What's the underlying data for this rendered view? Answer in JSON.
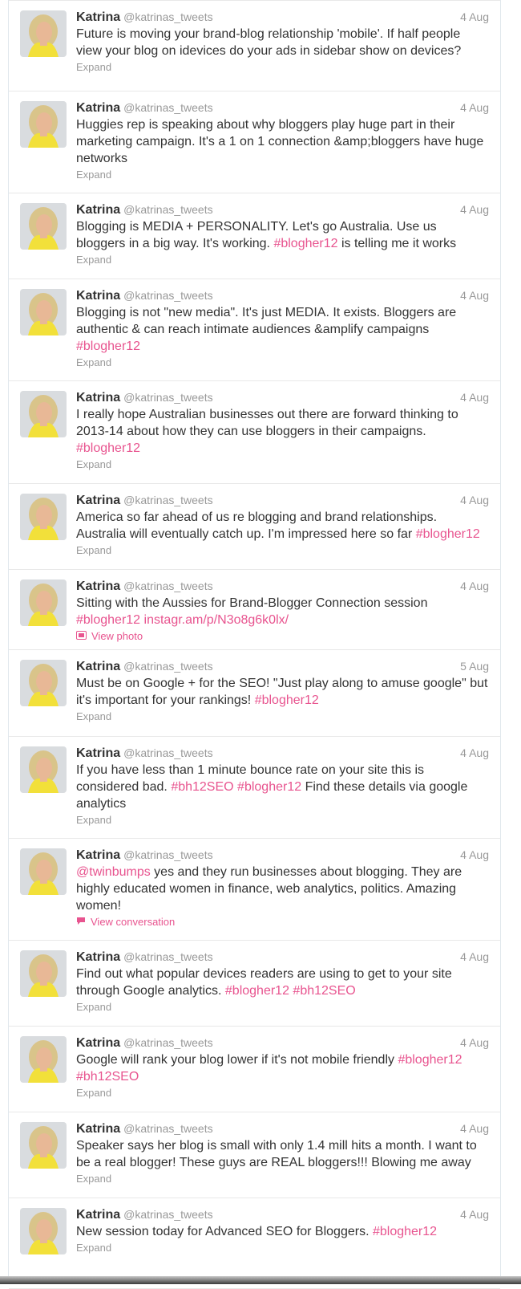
{
  "colors": {
    "link": "#e8548f",
    "muted": "#999999",
    "text": "#333333",
    "avatar_background": "#d9dcdf",
    "avatar_hair": "#d9c48a",
    "avatar_top": "#f2e03a"
  },
  "tweets": [
    {
      "name": "Katrina",
      "handle": "@katrinas_tweets",
      "date": "4 Aug",
      "segments": [
        {
          "t": "Future is moving your brand-blog relationship 'mobile'. If half people view your blog on idevices do your ads in sidebar show on devices?"
        }
      ],
      "action": "Expand"
    },
    {
      "name": "Katrina",
      "handle": "@katrinas_tweets",
      "date": "4 Aug",
      "segments": [
        {
          "t": "Huggies rep is speaking about why bloggers play huge part in their marketing campaign. It's a 1 on 1 connection &amp;bloggers have huge networks"
        }
      ],
      "action": "Expand"
    },
    {
      "name": "Katrina",
      "handle": "@katrinas_tweets",
      "date": "4 Aug",
      "segments": [
        {
          "t": "Blogging is MEDIA + PERSONALITY. Let's go Australia. Use us bloggers in a big way. It's working. "
        },
        {
          "t": "#blogher12",
          "link": true
        },
        {
          "t": " is telling me it works"
        }
      ],
      "action": "Expand"
    },
    {
      "name": "Katrina",
      "handle": "@katrinas_tweets",
      "date": "4 Aug",
      "segments": [
        {
          "t": "Blogging is not \"new media\". It's just MEDIA. It exists. Bloggers are authentic & can reach intimate audiences &amplify campaigns "
        },
        {
          "t": "#blogher12",
          "link": true
        }
      ],
      "action": "Expand"
    },
    {
      "name": "Katrina",
      "handle": "@katrinas_tweets",
      "date": "4 Aug",
      "segments": [
        {
          "t": "I really hope Australian businesses out there are forward thinking to 2013-14 about how they can use bloggers in their campaigns. "
        },
        {
          "t": "#blogher12",
          "link": true
        }
      ],
      "action": "Expand"
    },
    {
      "name": "Katrina",
      "handle": "@katrinas_tweets",
      "date": "4 Aug",
      "segments": [
        {
          "t": "America so far ahead of us re blogging and brand relationships. Australia will eventually catch up. I'm impressed here so far "
        },
        {
          "t": "#blogher12",
          "link": true
        }
      ],
      "action": "Expand"
    },
    {
      "name": "Katrina",
      "handle": "@katrinas_tweets",
      "date": "4 Aug",
      "segments": [
        {
          "t": "Sitting with the Aussies for Brand-Blogger Connection session "
        },
        {
          "t": "#blogher12",
          "link": true
        },
        {
          "t": " "
        },
        {
          "t": "instagr.am/p/N3o8g6k0lx/",
          "link": true
        }
      ],
      "action": "View photo",
      "action_icon": "photo-icon"
    },
    {
      "name": "Katrina",
      "handle": "@katrinas_tweets",
      "date": "5 Aug",
      "segments": [
        {
          "t": "Must be on Google + for the SEO! \"Just play along to amuse google\" but it's important for your rankings! "
        },
        {
          "t": "#blogher12",
          "link": true
        }
      ],
      "action": "Expand"
    },
    {
      "name": "Katrina",
      "handle": "@katrinas_tweets",
      "date": "4 Aug",
      "segments": [
        {
          "t": "If you have less than 1 minute bounce rate on your site this is considered bad. "
        },
        {
          "t": "#bh12SEO",
          "link": true
        },
        {
          "t": " "
        },
        {
          "t": "#blogher12",
          "link": true
        },
        {
          "t": " Find these details via google analytics"
        }
      ],
      "action": "Expand"
    },
    {
      "name": "Katrina",
      "handle": "@katrinas_tweets",
      "date": "4 Aug",
      "segments": [
        {
          "t": "@twinbumps",
          "link": true
        },
        {
          "t": " yes and they run businesses about blogging. They are highly educated women in finance, web analytics, politics. Amazing women!"
        }
      ],
      "action": "View conversation",
      "action_icon": "speech-bubble-icon"
    },
    {
      "name": "Katrina",
      "handle": "@katrinas_tweets",
      "date": "4 Aug",
      "segments": [
        {
          "t": "Find out what popular devices readers are using to get to your site through Google analytics. "
        },
        {
          "t": "#blogher12",
          "link": true
        },
        {
          "t": " "
        },
        {
          "t": "#bh12SEO",
          "link": true
        }
      ],
      "action": "Expand"
    },
    {
      "name": "Katrina",
      "handle": "@katrinas_tweets",
      "date": "4 Aug",
      "segments": [
        {
          "t": "Google will rank your blog lower if it's not mobile friendly "
        },
        {
          "t": "#blogher12",
          "link": true
        },
        {
          "t": " "
        },
        {
          "t": "#bh12SEO",
          "link": true
        }
      ],
      "action": "Expand"
    },
    {
      "name": "Katrina",
      "handle": "@katrinas_tweets",
      "date": "4 Aug",
      "segments": [
        {
          "t": "Speaker says her blog is small with only 1.4 mill hits a month. I want to be a real blogger! These guys are REAL bloggers!!! Blowing me away"
        }
      ],
      "action": "Expand"
    },
    {
      "name": "Katrina",
      "handle": "@katrinas_tweets",
      "date": "4 Aug",
      "segments": [
        {
          "t": "New session today for Advanced SEO for Bloggers. "
        },
        {
          "t": "#blogher12",
          "link": true
        }
      ],
      "action": "Expand"
    }
  ]
}
